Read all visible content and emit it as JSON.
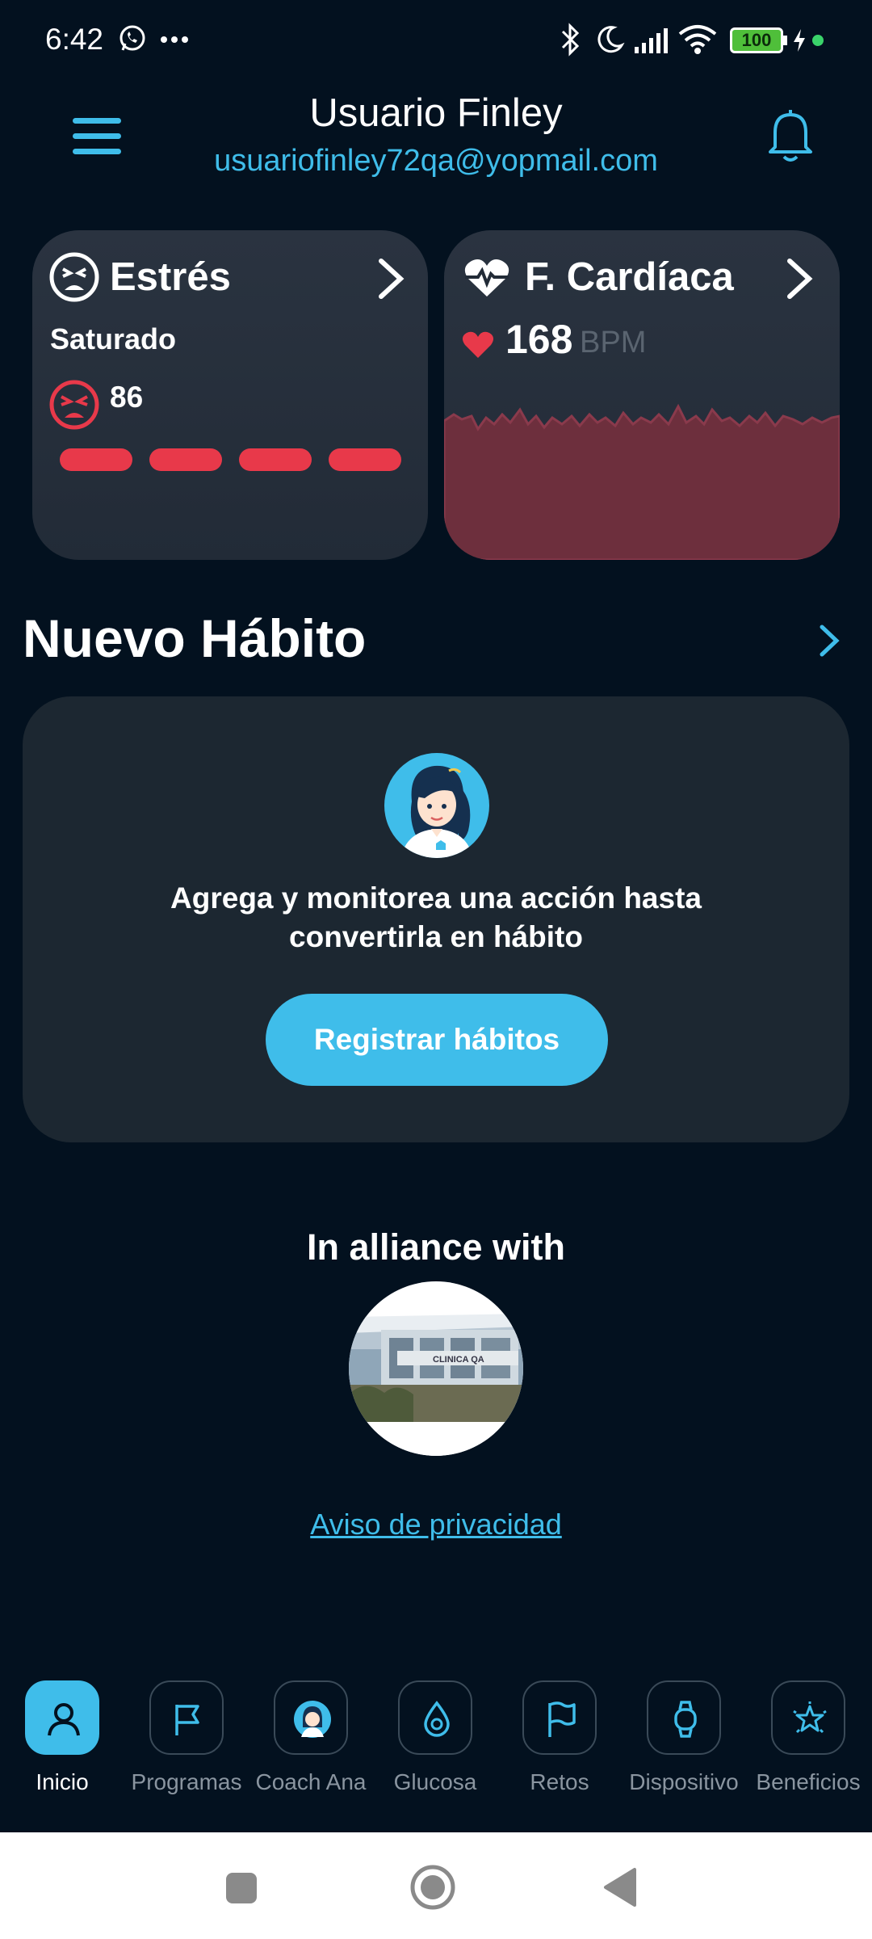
{
  "status_bar": {
    "time": "6:42",
    "battery": "100",
    "icons": [
      "whatsapp-icon",
      "more-icon",
      "bluetooth-icon",
      "moon-icon",
      "signal-icon",
      "wifi-icon",
      "battery-icon",
      "charging-icon"
    ]
  },
  "header": {
    "user_name": "Usuario Finley",
    "email": "usuariofinley72qa@yopmail.com"
  },
  "stress_card": {
    "title": "Estrés",
    "state": "Saturado",
    "value": "86",
    "color": "#e8394a"
  },
  "heart_card": {
    "title": "F. Cardíaca",
    "value": "168",
    "unit": "BPM",
    "color": "#e8394a"
  },
  "habit_section": {
    "title": "Nuevo Hábito",
    "description": "Agrega y monitorea una acción hasta convertirla en hábito",
    "button_label": "Registrar hábitos"
  },
  "alliance": {
    "title": "In alliance with",
    "logo_text": "CLINICA QA"
  },
  "privacy_link": "Aviso de privacidad",
  "bottom_nav": {
    "items": [
      {
        "label": "Inicio",
        "icon": "person-icon",
        "active": true
      },
      {
        "label": "Programas",
        "icon": "flag-icon",
        "active": false
      },
      {
        "label": "Coach Ana",
        "icon": "coach-avatar-icon",
        "active": false
      },
      {
        "label": "Glucosa",
        "icon": "glucose-drop-icon",
        "active": false
      },
      {
        "label": "Retos",
        "icon": "flag-outline-icon",
        "active": false
      },
      {
        "label": "Dispositivo",
        "icon": "watch-icon",
        "active": false
      },
      {
        "label": "Beneficios",
        "icon": "star-badge-icon",
        "active": false
      }
    ]
  },
  "colors": {
    "background": "#03111f",
    "accent": "#3fbdea",
    "card": "#1c2731",
    "alert": "#e8394a"
  }
}
